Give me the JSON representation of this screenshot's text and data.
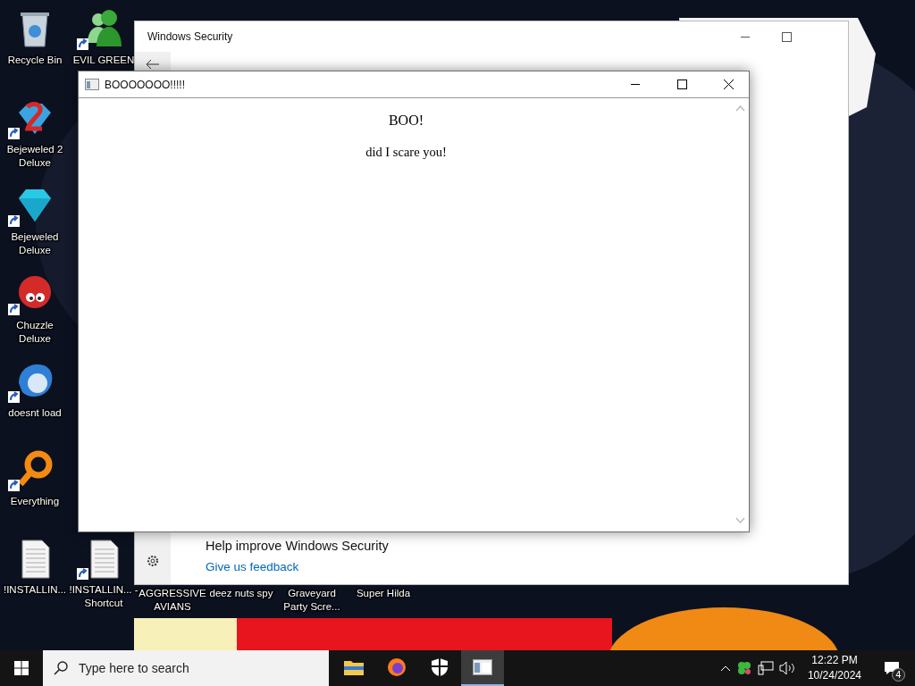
{
  "desktop_icons": [
    {
      "label": "Recycle Bin",
      "kind": "bin",
      "shortcut": false
    },
    {
      "label": "EVIL GREEN",
      "kind": "people",
      "shortcut": true
    },
    {
      "label": "Bejeweled 2 Deluxe",
      "kind": "gem2",
      "shortcut": true
    },
    {
      "label": "Bejeweled Deluxe",
      "kind": "gem",
      "shortcut": true
    },
    {
      "label": "Chuzzle Deluxe",
      "kind": "fuzzball",
      "shortcut": true
    },
    {
      "label": "doesnt load",
      "kind": "bird",
      "shortcut": true
    },
    {
      "label": "Everything",
      "kind": "ring",
      "shortcut": true
    },
    {
      "label": "!INSTALLIN...",
      "kind": "document",
      "shortcut": false
    },
    {
      "label": "!INSTALLIN... - Shortcut",
      "kind": "document",
      "shortcut": true
    },
    {
      "label": "AGGRESSIVE AVIANS",
      "kind": "none"
    },
    {
      "label": "deez nuts spy",
      "kind": "none"
    },
    {
      "label": "Graveyard Party Scre...",
      "kind": "none"
    },
    {
      "label": "Super Hilda",
      "kind": "none"
    }
  ],
  "windows_security": {
    "title": "Windows Security",
    "feedback_heading": "Help improve Windows Security",
    "feedback_link": "Give us feedback"
  },
  "popup": {
    "title": "BOOOOOOO!!!!!",
    "heading": "BOO!",
    "message": "did I scare you!"
  },
  "taskbar": {
    "search_placeholder": "Type here to search",
    "apps": [
      {
        "kind": "explorer",
        "selected": false
      },
      {
        "kind": "firefox",
        "selected": false
      },
      {
        "kind": "shield",
        "selected": false
      },
      {
        "kind": "window",
        "selected": true
      }
    ],
    "time": "12:22 PM",
    "date": "10/24/2024",
    "notifications": "4"
  }
}
